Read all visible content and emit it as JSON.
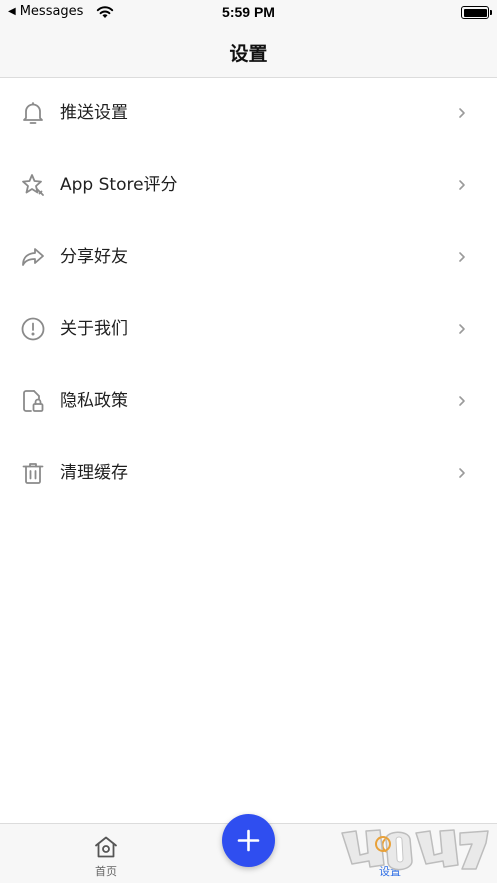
{
  "status_bar": {
    "back_label": "Messages",
    "time": "5:59 PM"
  },
  "nav": {
    "title": "设置"
  },
  "settings": [
    {
      "icon": "bell-icon",
      "label": "推送设置"
    },
    {
      "icon": "star-rating-icon",
      "label": "App Store评分"
    },
    {
      "icon": "share-arrow-icon",
      "label": "分享好友"
    },
    {
      "icon": "info-circle-icon",
      "label": "关于我们"
    },
    {
      "icon": "privacy-lock-icon",
      "label": "隐私政策"
    },
    {
      "icon": "trash-icon",
      "label": "清理缓存"
    }
  ],
  "tab_bar": {
    "home_label": "首页",
    "settings_label": "设置",
    "add_button": "+"
  },
  "watermark": {
    "text": "4u07.com"
  },
  "colors": {
    "accent": "#2f4ef0",
    "tab_active": "#2f6fe6",
    "icon_gray": "#8a8a8a"
  }
}
